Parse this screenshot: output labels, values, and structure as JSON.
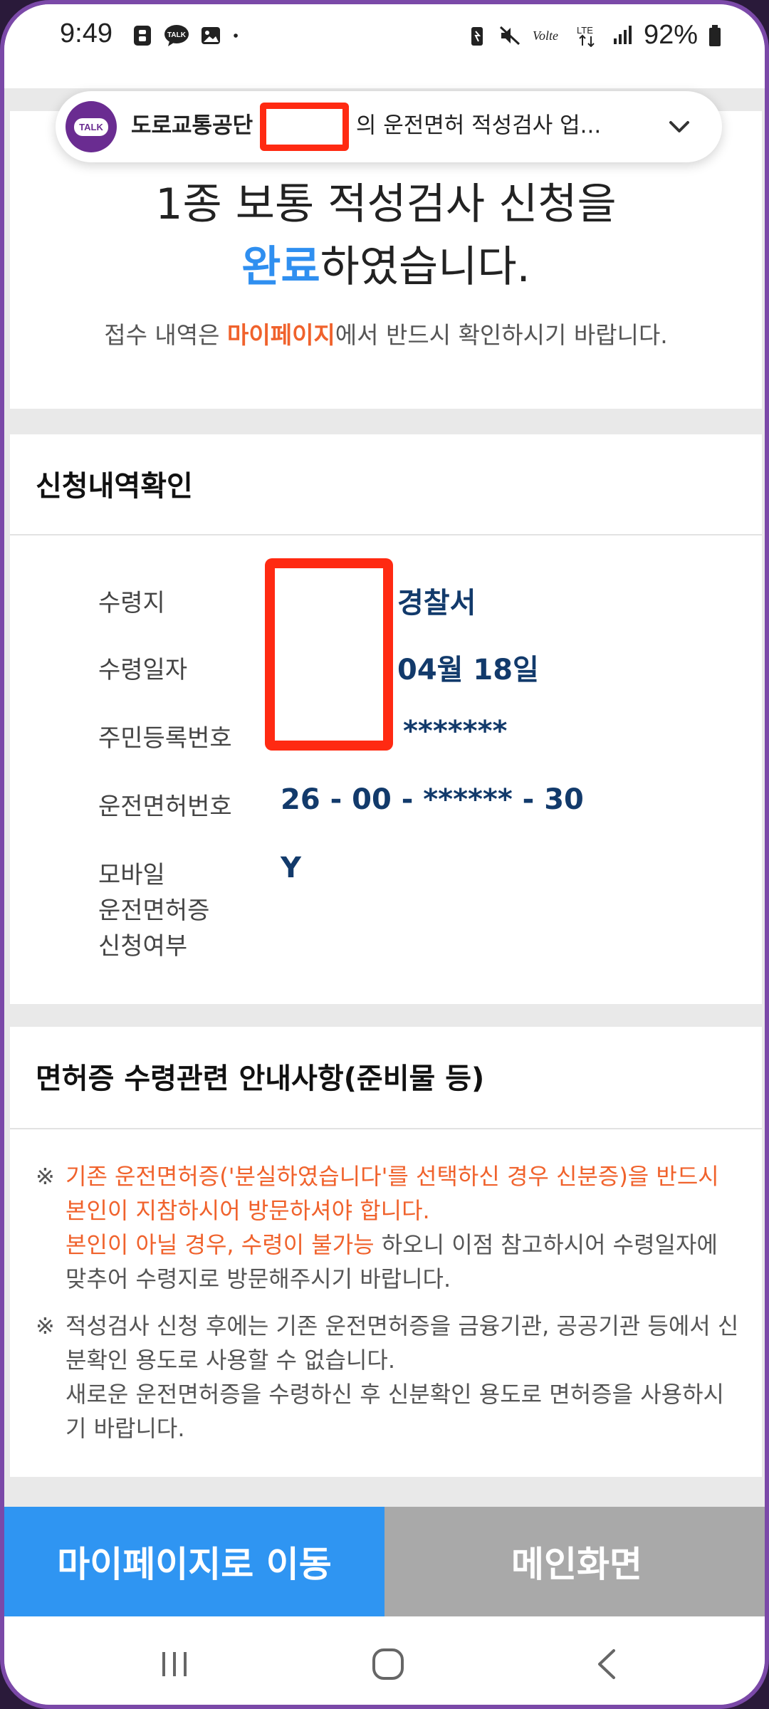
{
  "status_bar": {
    "time": "9:49",
    "battery": "92%",
    "left_icons": [
      "band-icon",
      "kakaotalk-icon",
      "gallery-icon",
      "dot-icon"
    ],
    "right_icons": [
      "battery-saver-icon",
      "mute-icon",
      "volte-icon",
      "lte-icon",
      "signal-icon",
      "battery-icon"
    ]
  },
  "notification": {
    "app_icon_label": "TALK",
    "sender": "도로교통공단",
    "message": "의 운전면허 적성검사 업..."
  },
  "completion": {
    "line1": "1종 보통 적성검사 신청을",
    "line2_accent": "완료",
    "line2_rest": "하였습니다.",
    "note_prefix": "접수 내역은 ",
    "note_link": "마이페이지",
    "note_suffix": "에서 반드시 확인하시기 바랍니다."
  },
  "history": {
    "title": "신청내역확인",
    "rows": [
      {
        "label": "수령지",
        "value": "경찰서"
      },
      {
        "label": "수령일자",
        "value": "04월 18일"
      },
      {
        "label": "주민등록번호",
        "value": "*******"
      },
      {
        "label": "운전면허번호",
        "value": "26 - 00 - ****** - 30"
      },
      {
        "label": "모바일\n운전면허증\n신청여부",
        "value": "Y"
      }
    ]
  },
  "guide": {
    "title": "면허증 수령관련 안내사항(준비물 등)",
    "mark": "※",
    "item1_red1": "기존 운전면허증('분실하였습니다'를 선택하신 경우 신분증)을 반드시 본인이 지참하시어 방문하셔야 합니다.",
    "item1_red2": "본인이 아닐 경우, 수령이 불가능",
    "item1_rest": " 하오니 이점 참고하시어 수령일자에 맞추어 수령지로 방문해주시기 바랍니다.",
    "item2": "적성검사 신청 후에는 기존 운전면허증을 금융기관, 공공기관 등에서 신분확인 용도로 사용할 수 없습니다.",
    "item2b": "새로운 운전면허증을 수령하신 후 신분확인 용도로 면허증을 사용하시기 바랍니다."
  },
  "buttons": {
    "mypage": "마이페이지로 이동",
    "main": "메인화면"
  },
  "colors": {
    "accent_blue": "#2f8ff0",
    "accent_orange": "#f0622c",
    "value_navy": "#123a6b",
    "button_blue": "#2f95f2",
    "button_gray": "#a9a9a9",
    "redaction": "#ff2a12"
  }
}
